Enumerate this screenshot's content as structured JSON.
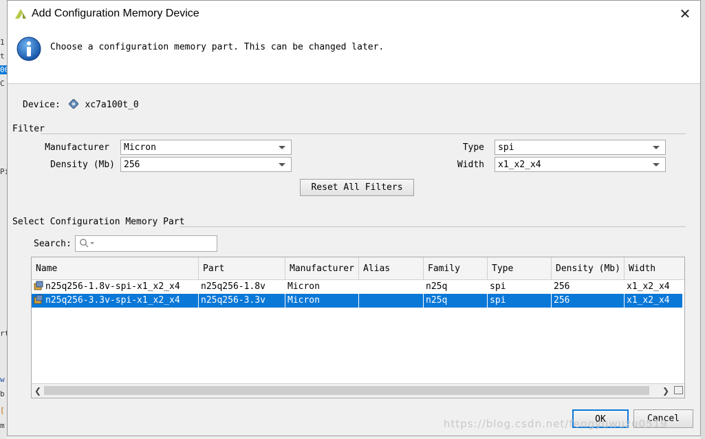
{
  "window": {
    "title": "Add Configuration Memory Device"
  },
  "banner": {
    "message": "Choose a configuration memory part. This can be changed later."
  },
  "device": {
    "label": "Device:",
    "name": "xc7a100t_0"
  },
  "filter": {
    "section_label": "Filter",
    "manufacturer_label": "Manufacturer",
    "manufacturer_value": "Micron",
    "density_label": "Density (Mb)",
    "density_value": "256",
    "type_label": "Type",
    "type_value": "spi",
    "width_label": "Width",
    "width_value": "x1_x2_x4",
    "reset_label": "Reset All Filters"
  },
  "parts": {
    "section_label": "Select Configuration Memory Part",
    "search_label": "Search:",
    "search_placeholder": "",
    "columns": [
      "Name",
      "Part",
      "Manufacturer",
      "Alias",
      "Family",
      "Type",
      "Density (Mb)",
      "Width"
    ],
    "rows": [
      {
        "name": "n25q256-1.8v-spi-x1_x2_x4",
        "part": "n25q256-1.8v",
        "manufacturer": "Micron",
        "alias": "",
        "family": "n25q",
        "type": "spi",
        "density": "256",
        "width": "x1_x2_x4",
        "selected": false
      },
      {
        "name": "n25q256-3.3v-spi-x1_x2_x4",
        "part": "n25q256-3.3v",
        "manufacturer": "Micron",
        "alias": "",
        "family": "n25q",
        "type": "spi",
        "density": "256",
        "width": "x1_x2_x4",
        "selected": true
      }
    ]
  },
  "buttons": {
    "ok": "OK",
    "cancel": "Cancel"
  },
  "watermark": "https://blog.csdn.net/fengyuwuzu0519",
  "background_fragments": [
    "1",
    "t",
    "00",
    "C",
    "Pi",
    "rt",
    "w",
    "b",
    "[",
    "m"
  ],
  "colors": {
    "selection": "#0a78d7",
    "banner_bg": "#ffffff",
    "dialog_bg": "#f0f0f0"
  }
}
